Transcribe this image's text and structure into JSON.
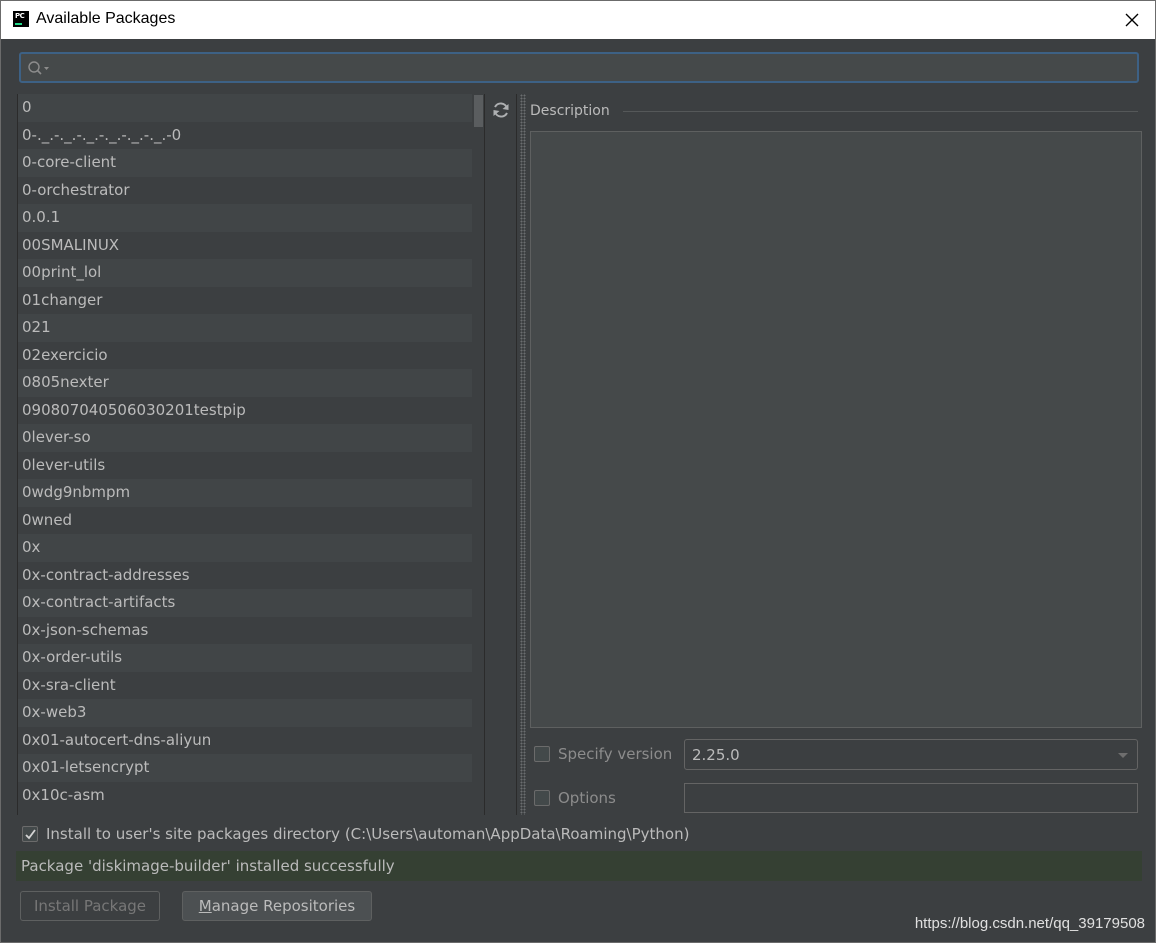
{
  "window": {
    "title": "Available Packages"
  },
  "search": {
    "value": "",
    "placeholder": ""
  },
  "packages": [
    "0",
    "0-._.-._.-._.-._.-._.-._.-0",
    "0-core-client",
    "0-orchestrator",
    "0.0.1",
    "00SMALINUX",
    "00print_lol",
    "01changer",
    "021",
    "02exercicio",
    "0805nexter",
    "090807040506030201testpip",
    "0lever-so",
    "0lever-utils",
    "0wdg9nbmpm",
    "0wned",
    "0x",
    "0x-contract-addresses",
    "0x-contract-artifacts",
    "0x-json-schemas",
    "0x-order-utils",
    "0x-sra-client",
    "0x-web3",
    "0x01-autocert-dns-aliyun",
    "0x01-letsencrypt",
    "0x10c-asm"
  ],
  "description": {
    "label": "Description"
  },
  "specify_version": {
    "label": "Specify version",
    "checked": false,
    "value": "2.25.0"
  },
  "options": {
    "label": "Options",
    "checked": false,
    "value": ""
  },
  "install_to_user": {
    "label": "Install to user's site packages directory (C:\\Users\\automan\\AppData\\Roaming\\Python)",
    "checked": true
  },
  "status": {
    "text": "Package 'diskimage-builder' installed successfully"
  },
  "buttons": {
    "install_label": "Install Package",
    "manage_mnemonic": "M",
    "manage_rest": "anage Repositories"
  },
  "watermark": "https://blog.csdn.net/qq_39179508",
  "colors": {
    "background": "#3c3f41",
    "status_success": "#354033",
    "focus_border": "#3d6185"
  }
}
